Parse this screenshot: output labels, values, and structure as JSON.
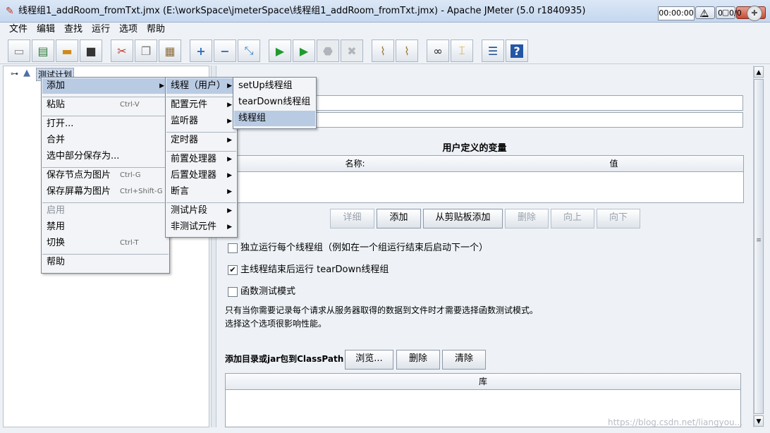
{
  "window": {
    "title": "线程组1_addRoom_fromTxt.jmx (E:\\workSpace\\jmeterSpace\\线程组1_addRoom_fromTxt.jmx) - Apache JMeter (5.0 r1840935)",
    "minimize": "▁",
    "maximize": "▢",
    "close": "✕"
  },
  "menubar": [
    "文件",
    "编辑",
    "查找",
    "运行",
    "选项",
    "帮助"
  ],
  "toolbar": {
    "icons": [
      "new-icon",
      "templates-icon",
      "open-icon",
      "save-icon",
      "cut-icon",
      "copy-icon",
      "paste-icon",
      "expand-icon",
      "collapse-icon",
      "toggle-icon",
      "start-icon",
      "start-no-timers-icon",
      "stop-icon",
      "shutdown-icon",
      "clear-icon",
      "clear-all-icon",
      "search-icon",
      "reset-search-icon",
      "function-helper-icon",
      "help-icon"
    ],
    "timer": "00:00:00",
    "warning_count": "0",
    "ratio": "0/0"
  },
  "tree": {
    "root_label": "测试计划"
  },
  "context_menu": {
    "items": [
      {
        "label": "添加",
        "submenu": true,
        "highlighted": true
      },
      {
        "label": "粘贴",
        "shortcut": "Ctrl-V"
      },
      {
        "label": "打开..."
      },
      {
        "label": "合并"
      },
      {
        "label": "选中部分保存为..."
      },
      {
        "label": "保存节点为图片",
        "shortcut": "Ctrl-G"
      },
      {
        "label": "保存屏幕为图片",
        "shortcut": "Ctrl+Shift-G"
      },
      {
        "label": "启用",
        "disabled": true
      },
      {
        "label": "禁用"
      },
      {
        "label": "切换",
        "shortcut": "Ctrl-T"
      },
      {
        "label": "帮助"
      }
    ]
  },
  "add_submenu": {
    "items": [
      {
        "label": "线程（用户）",
        "highlighted": true
      },
      {
        "label": "配置元件"
      },
      {
        "label": "监听器"
      },
      {
        "label": "定时器"
      },
      {
        "label": "前置处理器"
      },
      {
        "label": "后置处理器"
      },
      {
        "label": "断言"
      },
      {
        "label": "测试片段"
      },
      {
        "label": "非测试元件"
      }
    ]
  },
  "threads_submenu": {
    "items": [
      {
        "label": "setUp线程组"
      },
      {
        "label": "tearDown线程组"
      },
      {
        "label": "线程组",
        "highlighted": true
      }
    ]
  },
  "main": {
    "user_vars_title": "用户定义的变量",
    "columns": [
      "名称:",
      "值"
    ],
    "buttons": [
      "详细",
      "添加",
      "从剪贴板添加",
      "删除",
      "向上",
      "向下"
    ],
    "checkboxes": [
      {
        "label": "独立运行每个线程组（例如在一个组运行结束后启动下一个）",
        "checked": false
      },
      {
        "label": "主线程结束后运行 tearDown线程组",
        "checked": true
      },
      {
        "label": "函数测试模式",
        "checked": false
      }
    ],
    "desc_line1": "只有当你需要记录每个请求从服务器取得的数据到文件时才需要选择函数测试模式。",
    "desc_line2": "选择这个选项很影响性能。",
    "classpath_label": "添加目录或jar包到ClassPath",
    "classpath_buttons": [
      "浏览...",
      "删除",
      "清除"
    ],
    "lib_column": "库"
  },
  "watermark": "https://blog.csdn.net/liangyou..."
}
